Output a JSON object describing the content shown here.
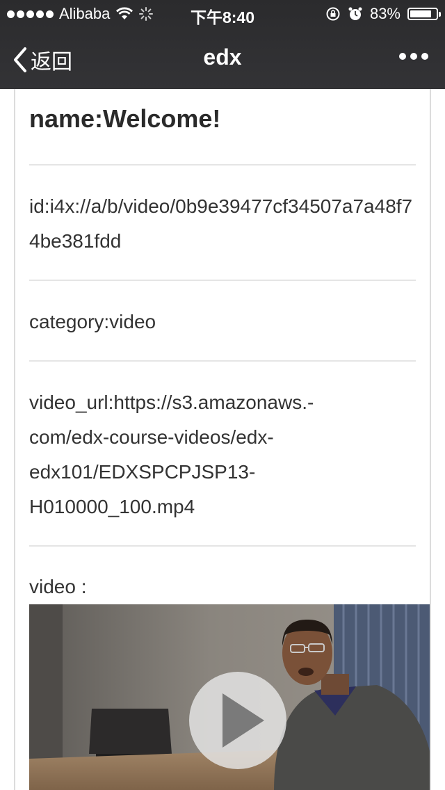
{
  "status_bar": {
    "carrier": "Alibaba",
    "time": "下午8:40",
    "battery_percent_text": "83%",
    "battery_level": 0.83
  },
  "nav": {
    "back_label": "返回",
    "title": "edx"
  },
  "detail": {
    "name_line": "name:Welcome!",
    "id_line": "id:i4x://a/b/video/0b9e39477cf34507a7a48f74be381fdd",
    "category_line": "category:video",
    "video_url_lines": [
      "video_url:https://s3.amazonaws.-",
      "com/edx-course-videos/edx-",
      "edx101/EDXSPCPJSP13-",
      "H010000_100.mp4"
    ],
    "video_label": "video :"
  },
  "colors": {
    "nav_background": "#2e2e30",
    "text": "#333333",
    "divider": "#e5e5e5"
  },
  "icons": {
    "back": "chevron-left-icon",
    "more": "more-dots-icon",
    "wifi": "wifi-icon",
    "loading": "spinner-icon",
    "rotation_lock": "rotation-lock-icon",
    "alarm": "alarm-icon",
    "battery": "battery-icon",
    "play": "play-icon"
  }
}
